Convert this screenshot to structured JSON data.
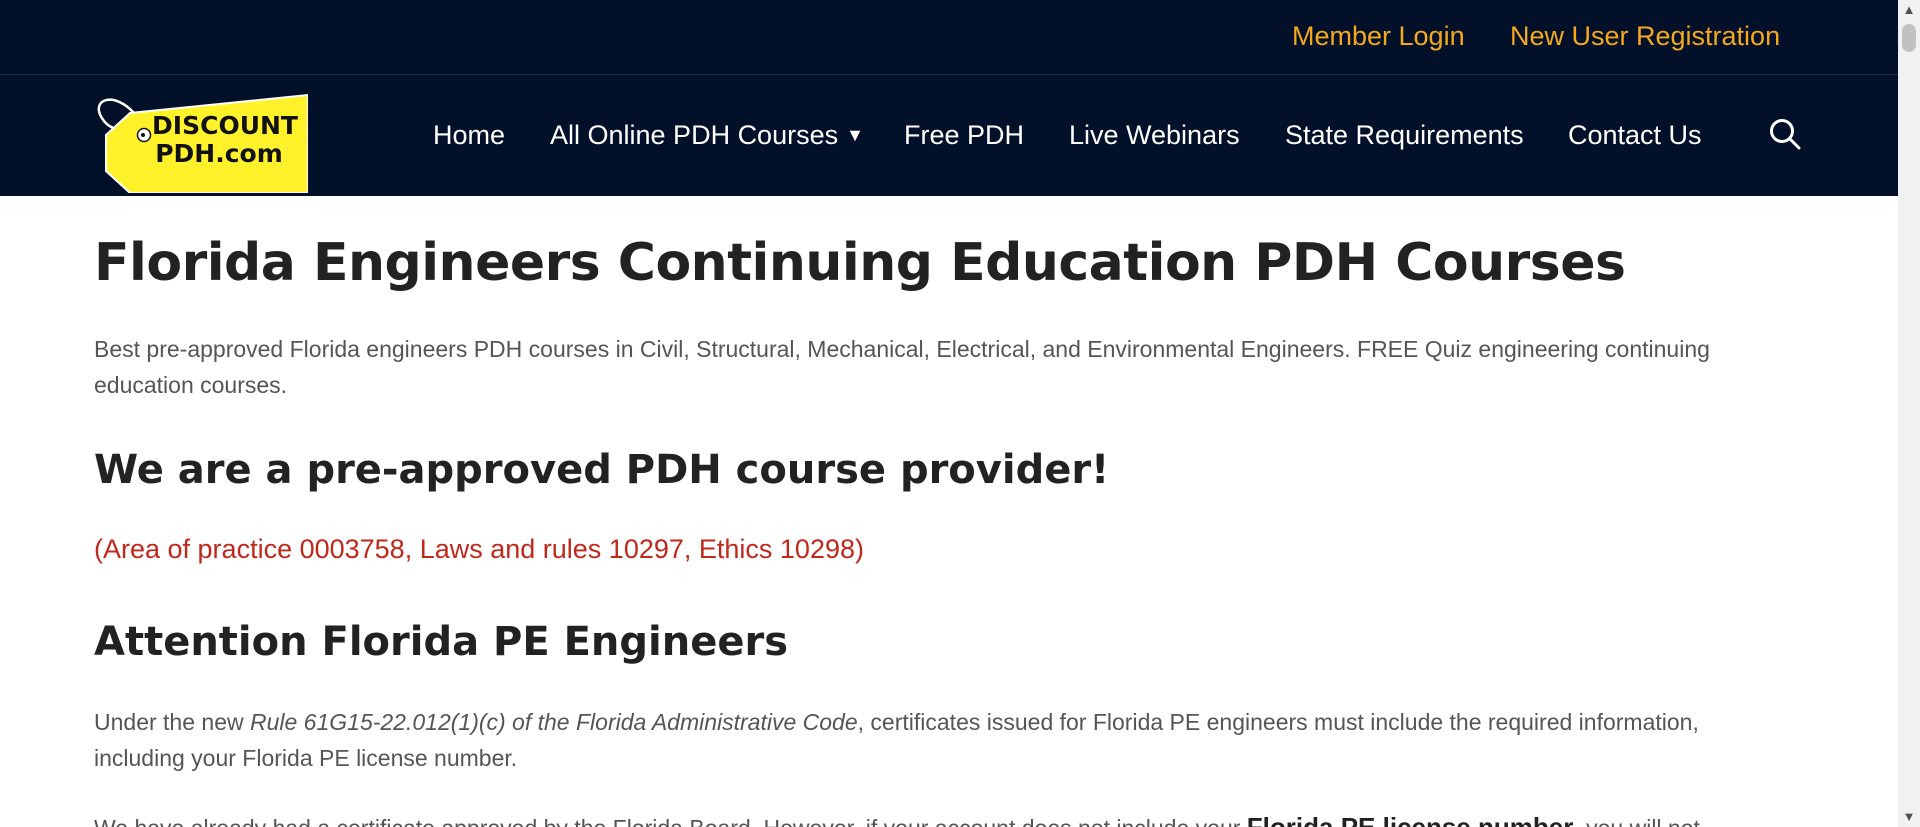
{
  "topbar": {
    "member_login": "Member Login",
    "new_user_registration": "New User Registration"
  },
  "logo": {
    "line1": "DISCOUNT",
    "line2": "PDH.com"
  },
  "nav": {
    "items": [
      "Home",
      "All Online PDH Courses",
      "Free PDH",
      "Live Webinars",
      "State Requirements",
      "Contact Us"
    ],
    "search_icon": "search-icon",
    "dropdown_icon": "caret-down-icon"
  },
  "main": {
    "title": "Florida Engineers Continuing Education PDH Courses",
    "intro": "Best pre-approved Florida engineers PDH courses in Civil, Structural, Mechanical, Electrical, and Environmental Engineers. FREE Quiz engineering continuing education courses.",
    "provider_heading": "We are a pre-approved PDH course provider!",
    "approval_numbers": "(Area of practice 0003758, Laws and rules 10297, Ethics 10298)",
    "attention_heading": "Attention Florida PE Engineers",
    "rule_prefix": "Under the new ",
    "rule_reference": "Rule 61G15-22.012(1)(c) of the Florida Administrative Code",
    "rule_suffix": ", certificates issued for Florida PE engineers must include the required information, including your Florida PE license number.",
    "cut_off_text": "We have already had a certificate approved by the Florida Board. However, if your account does not include your",
    "cut_off_bold": "Florida PE license number",
    "cut_off_tail": ", you will not"
  },
  "colors": {
    "header_bg": "#03102a",
    "top_links": "#f4a81d",
    "logo_yellow": "#fff22a",
    "approval_red": "#c0281b",
    "heading": "#222222",
    "body_text": "#555555"
  }
}
